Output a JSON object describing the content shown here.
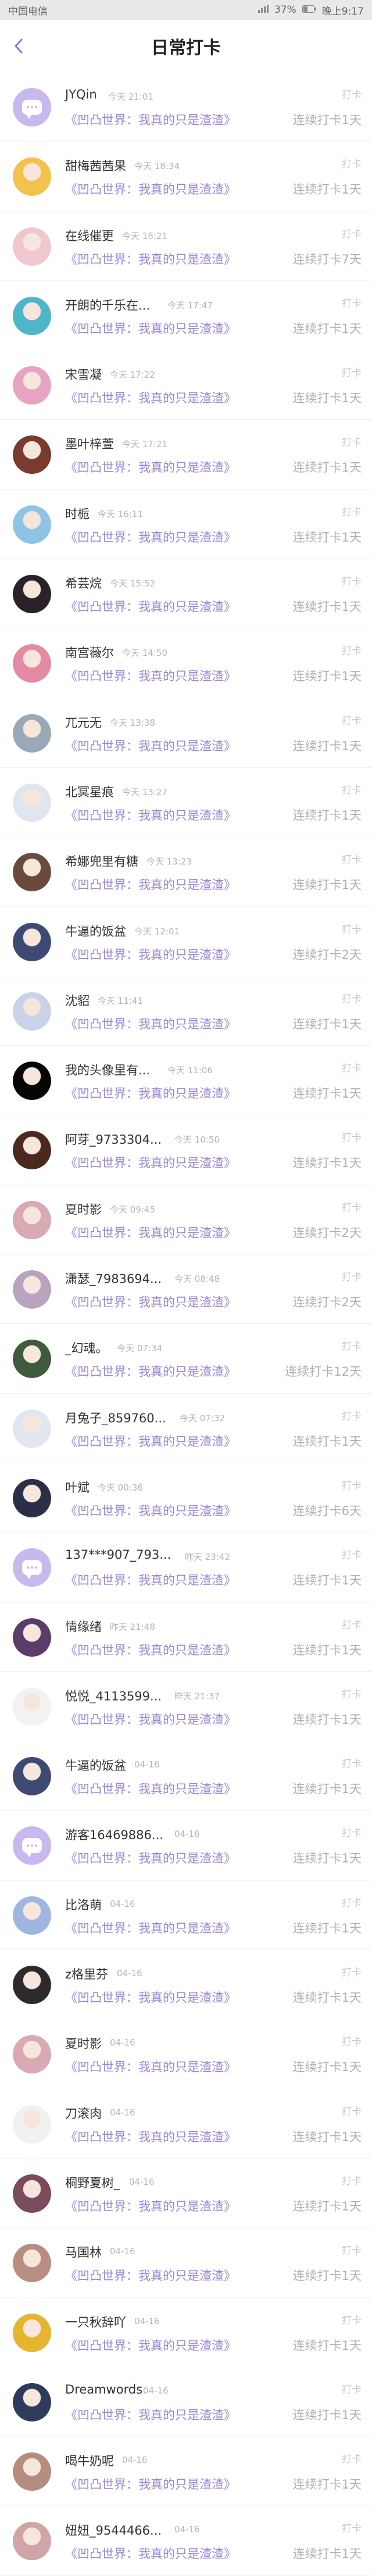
{
  "status_bar": {
    "carrier": "中国电信",
    "battery": "37%",
    "time": "晚上9:17"
  },
  "header": {
    "title": "日常打卡"
  },
  "icons": {
    "back": "chevron-left-icon",
    "default_avatar": "chat-bubble-icon"
  },
  "colors": {
    "accent": "#9b87d7",
    "default_avatar_bg": "#c8b8ee"
  },
  "entries": [
    {
      "name": "JYQin",
      "time": "今天 21:01",
      "book": "《凹凸世界：我真的只是渣渣》",
      "tag": "打卡",
      "streak": "连续打卡1天",
      "avatar": "default"
    },
    {
      "name": "甜梅茜茜果",
      "time": "今天 18:34",
      "book": "《凹凸世界：我真的只是渣渣》",
      "tag": "打卡",
      "streak": "连续打卡1天",
      "avatar": "img",
      "avatar_color": "#f2c14e"
    },
    {
      "name": "在线催更",
      "time": "今天 18:21",
      "book": "《凹凸世界：我真的只是渣渣》",
      "tag": "打卡",
      "streak": "连续打卡7天",
      "avatar": "img",
      "avatar_color": "#f0c6cf"
    },
    {
      "name": "开朗的千乐在...",
      "time": "今天 17:47",
      "book": "《凹凸世界：我真的只是渣渣》",
      "tag": "打卡",
      "streak": "连续打卡1天",
      "avatar": "img",
      "avatar_color": "#4fb6c9"
    },
    {
      "name": "宋雪凝",
      "time": "今天 17:22",
      "book": "《凹凸世界：我真的只是渣渣》",
      "tag": "打卡",
      "streak": "连续打卡1天",
      "avatar": "img",
      "avatar_color": "#e7a3c2"
    },
    {
      "name": "墨叶梓萱",
      "time": "今天 17:21",
      "book": "《凹凸世界：我真的只是渣渣》",
      "tag": "打卡",
      "streak": "连续打卡1天",
      "avatar": "img",
      "avatar_color": "#7b3a2f"
    },
    {
      "name": "时栀",
      "time": "今天 16:11",
      "book": "《凹凸世界：我真的只是渣渣》",
      "tag": "打卡",
      "streak": "连续打卡1天",
      "avatar": "img",
      "avatar_color": "#8ec5e6"
    },
    {
      "name": "希芸烷",
      "time": "今天 15:52",
      "book": "《凹凸世界：我真的只是渣渣》",
      "tag": "打卡",
      "streak": "连续打卡1天",
      "avatar": "img",
      "avatar_color": "#2b2128"
    },
    {
      "name": "南宫薇尔",
      "time": "今天 14:50",
      "book": "《凹凸世界：我真的只是渣渣》",
      "tag": "打卡",
      "streak": "连续打卡1天",
      "avatar": "img",
      "avatar_color": "#e58aa5"
    },
    {
      "name": "兀元无",
      "time": "今天 13:38",
      "book": "《凹凸世界：我真的只是渣渣》",
      "tag": "打卡",
      "streak": "连续打卡1天",
      "avatar": "img",
      "avatar_color": "#9aa9b8"
    },
    {
      "name": "北冥星痕",
      "time": "今天 13:27",
      "book": "《凹凸世界：我真的只是渣渣》",
      "tag": "打卡",
      "streak": "连续打卡1天",
      "avatar": "img",
      "avatar_color": "#dfe6ef"
    },
    {
      "name": "希娜兜里有糖",
      "time": "今天 13:23",
      "book": "《凹凸世界：我真的只是渣渣》",
      "tag": "打卡",
      "streak": "连续打卡1天",
      "avatar": "img",
      "avatar_color": "#6b4a3e"
    },
    {
      "name": "牛逼的饭盆",
      "time": "今天 12:01",
      "book": "《凹凸世界：我真的只是渣渣》",
      "tag": "打卡",
      "streak": "连续打卡2天",
      "avatar": "img",
      "avatar_color": "#3d4a73"
    },
    {
      "name": "沈貂",
      "time": "今天 11:41",
      "book": "《凹凸世界：我真的只是渣渣》",
      "tag": "打卡",
      "streak": "连续打卡1天",
      "avatar": "img",
      "avatar_color": "#c9d3e8"
    },
    {
      "name": "我的头像里有...",
      "time": "今天 11:06",
      "book": "《凹凸世界：我真的只是渣渣》",
      "tag": "打卡",
      "streak": "连续打卡1天",
      "avatar": "img",
      "avatar_color": "#050505"
    },
    {
      "name": "阿芽_9733304...",
      "time": "今天 10:50",
      "book": "《凹凸世界：我真的只是渣渣》",
      "tag": "打卡",
      "streak": "连续打卡1天",
      "avatar": "img",
      "avatar_color": "#4a2a1c"
    },
    {
      "name": "夏时影",
      "time": "今天 09:45",
      "book": "《凹凸世界：我真的只是渣渣》",
      "tag": "打卡",
      "streak": "连续打卡2天",
      "avatar": "img",
      "avatar_color": "#d9a9b5"
    },
    {
      "name": "潇瑟_7983694...",
      "time": "今天 08:48",
      "book": "《凹凸世界：我真的只是渣渣》",
      "tag": "打卡",
      "streak": "连续打卡2天",
      "avatar": "img",
      "avatar_color": "#b9a3bf"
    },
    {
      "name": "_幻魂。",
      "time": "今天 07:34",
      "book": "《凹凸世界：我真的只是渣渣》",
      "tag": "打卡",
      "streak": "连续打卡12天",
      "avatar": "img",
      "avatar_color": "#3f5a3c"
    },
    {
      "name": "月兔子_859760...",
      "time": "今天 07:32",
      "book": "《凹凸世界：我真的只是渣渣》",
      "tag": "打卡",
      "streak": "连续打卡1天",
      "avatar": "img",
      "avatar_color": "#e2e7ef"
    },
    {
      "name": "叶斌",
      "time": "今天 00:36",
      "book": "《凹凸世界：我真的只是渣渣》",
      "tag": "打卡",
      "streak": "连续打卡6天",
      "avatar": "img",
      "avatar_color": "#2a2f47"
    },
    {
      "name": "137***907_793...",
      "time": "昨天 23:42",
      "book": "《凹凸世界：我真的只是渣渣》",
      "tag": "打卡",
      "streak": "连续打卡1天",
      "avatar": "default"
    },
    {
      "name": "情缘绪",
      "time": "昨天 21:48",
      "book": "《凹凸世界：我真的只是渣渣》",
      "tag": "打卡",
      "streak": "连续打卡1天",
      "avatar": "img",
      "avatar_color": "#5d3b6b"
    },
    {
      "name": "悦悦_4113599...",
      "time": "昨天 21:37",
      "book": "《凹凸世界：我真的只是渣渣》",
      "tag": "打卡",
      "streak": "连续打卡1天",
      "avatar": "img",
      "avatar_color": "#f2f2f2"
    },
    {
      "name": "牛逼的饭盆",
      "time": "04-16",
      "book": "《凹凸世界：我真的只是渣渣》",
      "tag": "打卡",
      "streak": "连续打卡1天",
      "avatar": "img",
      "avatar_color": "#3d4a73"
    },
    {
      "name": "游客16469886...",
      "time": "04-16",
      "book": "《凹凸世界：我真的只是渣渣》",
      "tag": "打卡",
      "streak": "连续打卡1天",
      "avatar": "default"
    },
    {
      "name": "比洛萌",
      "time": "04-16",
      "book": "《凹凸世界：我真的只是渣渣》",
      "tag": "打卡",
      "streak": "连续打卡1天",
      "avatar": "img",
      "avatar_color": "#9fb6e0"
    },
    {
      "name": "z格里芬",
      "time": "04-16",
      "book": "《凹凸世界：我真的只是渣渣》",
      "tag": "打卡",
      "streak": "连续打卡1天",
      "avatar": "img",
      "avatar_color": "#2c2a2a"
    },
    {
      "name": "夏时影",
      "time": "04-16",
      "book": "《凹凸世界：我真的只是渣渣》",
      "tag": "打卡",
      "streak": "连续打卡1天",
      "avatar": "img",
      "avatar_color": "#d9a9b5"
    },
    {
      "name": "刀滚肉",
      "time": "04-16",
      "book": "《凹凸世界：我真的只是渣渣》",
      "tag": "打卡",
      "streak": "连续打卡1天",
      "avatar": "img",
      "avatar_color": "#f1f1f1"
    },
    {
      "name": "桐野夏树_",
      "time": "04-16",
      "book": "《凹凸世界：我真的只是渣渣》",
      "tag": "打卡",
      "streak": "连续打卡1天",
      "avatar": "img",
      "avatar_color": "#7a4b5d"
    },
    {
      "name": "马国林",
      "time": "04-16",
      "book": "《凹凸世界：我真的只是渣渣》",
      "tag": "打卡",
      "streak": "连续打卡1天",
      "avatar": "img",
      "avatar_color": "#b88e82"
    },
    {
      "name": "一只秋辞吖",
      "time": "04-16",
      "book": "《凹凸世界：我真的只是渣渣》",
      "tag": "打卡",
      "streak": "连续打卡1天",
      "avatar": "img",
      "avatar_color": "#e6b530"
    },
    {
      "name": "Dreamwords",
      "time": "04-16",
      "book": "《凹凸世界：我真的只是渣渣》",
      "tag": "打卡",
      "streak": "连续打卡1天",
      "avatar": "img",
      "avatar_color": "#2f3b5c"
    },
    {
      "name": "喝牛奶呢",
      "time": "04-16",
      "book": "《凹凸世界：我真的只是渣渣》",
      "tag": "打卡",
      "streak": "连续打卡1天",
      "avatar": "img",
      "avatar_color": "#b58d7e"
    },
    {
      "name": "妞妞_9544466...",
      "time": "04-16",
      "book": "《凹凸世界：我真的只是渣渣》",
      "tag": "打卡",
      "streak": "连续打卡1天",
      "avatar": "img",
      "avatar_color": "#cfa5a8"
    }
  ]
}
